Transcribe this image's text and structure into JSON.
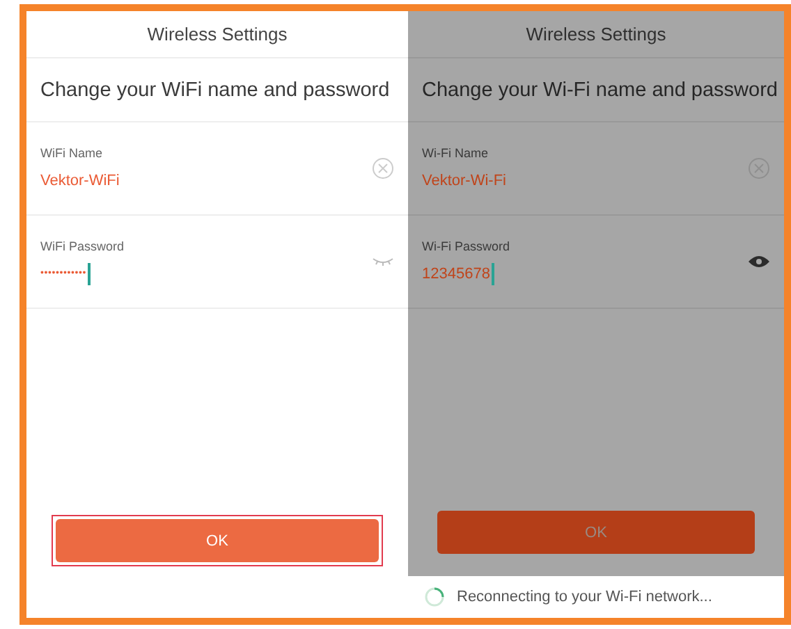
{
  "screens": [
    {
      "title": "Wireless Settings",
      "heading": "Change your WiFi name and password",
      "dimmed": false,
      "fields": [
        {
          "kind": "name",
          "label": "WiFi Name",
          "value": "Vektor-WiFi",
          "focused": false
        },
        {
          "kind": "password",
          "label": "WiFi Password",
          "value": "••••••••••••",
          "masked": true,
          "focused": true
        }
      ],
      "button": {
        "label": "OK",
        "highlighted": true
      }
    },
    {
      "title": "Wireless Settings",
      "heading": "Change your Wi-Fi name and password",
      "dimmed": true,
      "fields": [
        {
          "kind": "name",
          "label": "Wi-Fi Name",
          "value": "Vektor-Wi-Fi",
          "focused": false
        },
        {
          "kind": "password",
          "label": "Wi-Fi Password",
          "value": "12345678",
          "masked": false,
          "focused": true
        }
      ],
      "button": {
        "label": "OK",
        "highlighted": false
      },
      "status": "Reconnecting to your Wi-Fi network..."
    }
  ]
}
